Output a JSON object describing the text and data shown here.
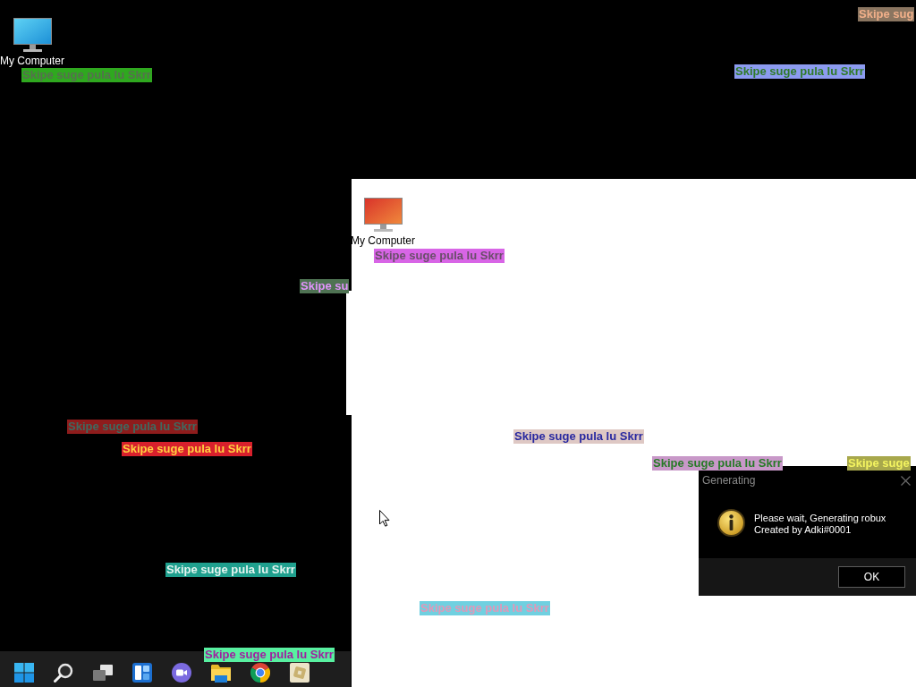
{
  "desktop": {
    "icons": [
      {
        "label": "My Computer"
      }
    ]
  },
  "desktop_copy": {
    "icons": [
      {
        "label": "My Computer"
      }
    ]
  },
  "floating_labels": [
    {
      "text": "Skipe sug",
      "color": "#8a7560"
    },
    {
      "text": "Skipe suge pula lu Skrr",
      "color": "#2fa81f"
    },
    {
      "text": "Skipe suge pula lu Skrr",
      "color": "#8c9bf0"
    },
    {
      "text": "Skipe suge pula lu Skrr",
      "color": "#d865e6"
    },
    {
      "text": "Skipe su",
      "color": "#4e7252"
    },
    {
      "text": "Skipe suge pula lu Skrr",
      "color": "#8e1c1c"
    },
    {
      "text": "Skipe suge pula lu Skrr",
      "color": "#dec8c4"
    },
    {
      "text": "Skipe suge pula lu Skrr",
      "color": "#d8202c"
    },
    {
      "text": "Skipe suge pula lu Skrr",
      "color": "#c898c8"
    },
    {
      "text": "Skipe suge",
      "color": "#a8a84c"
    },
    {
      "text": "Skipe suge pula lu Skrr",
      "color": "#1fa08e"
    },
    {
      "text": "Skipe suge pula lu Skrr",
      "color": "#70d0e0"
    },
    {
      "text": "Skipe suge pula lu Skrr",
      "color": "#58f0a0"
    }
  ],
  "dialog": {
    "title": "Generating",
    "message_lines": [
      "Please wait, Generating robux",
      "Created by Adki#0001"
    ],
    "buttons": [
      "OK"
    ]
  }
}
